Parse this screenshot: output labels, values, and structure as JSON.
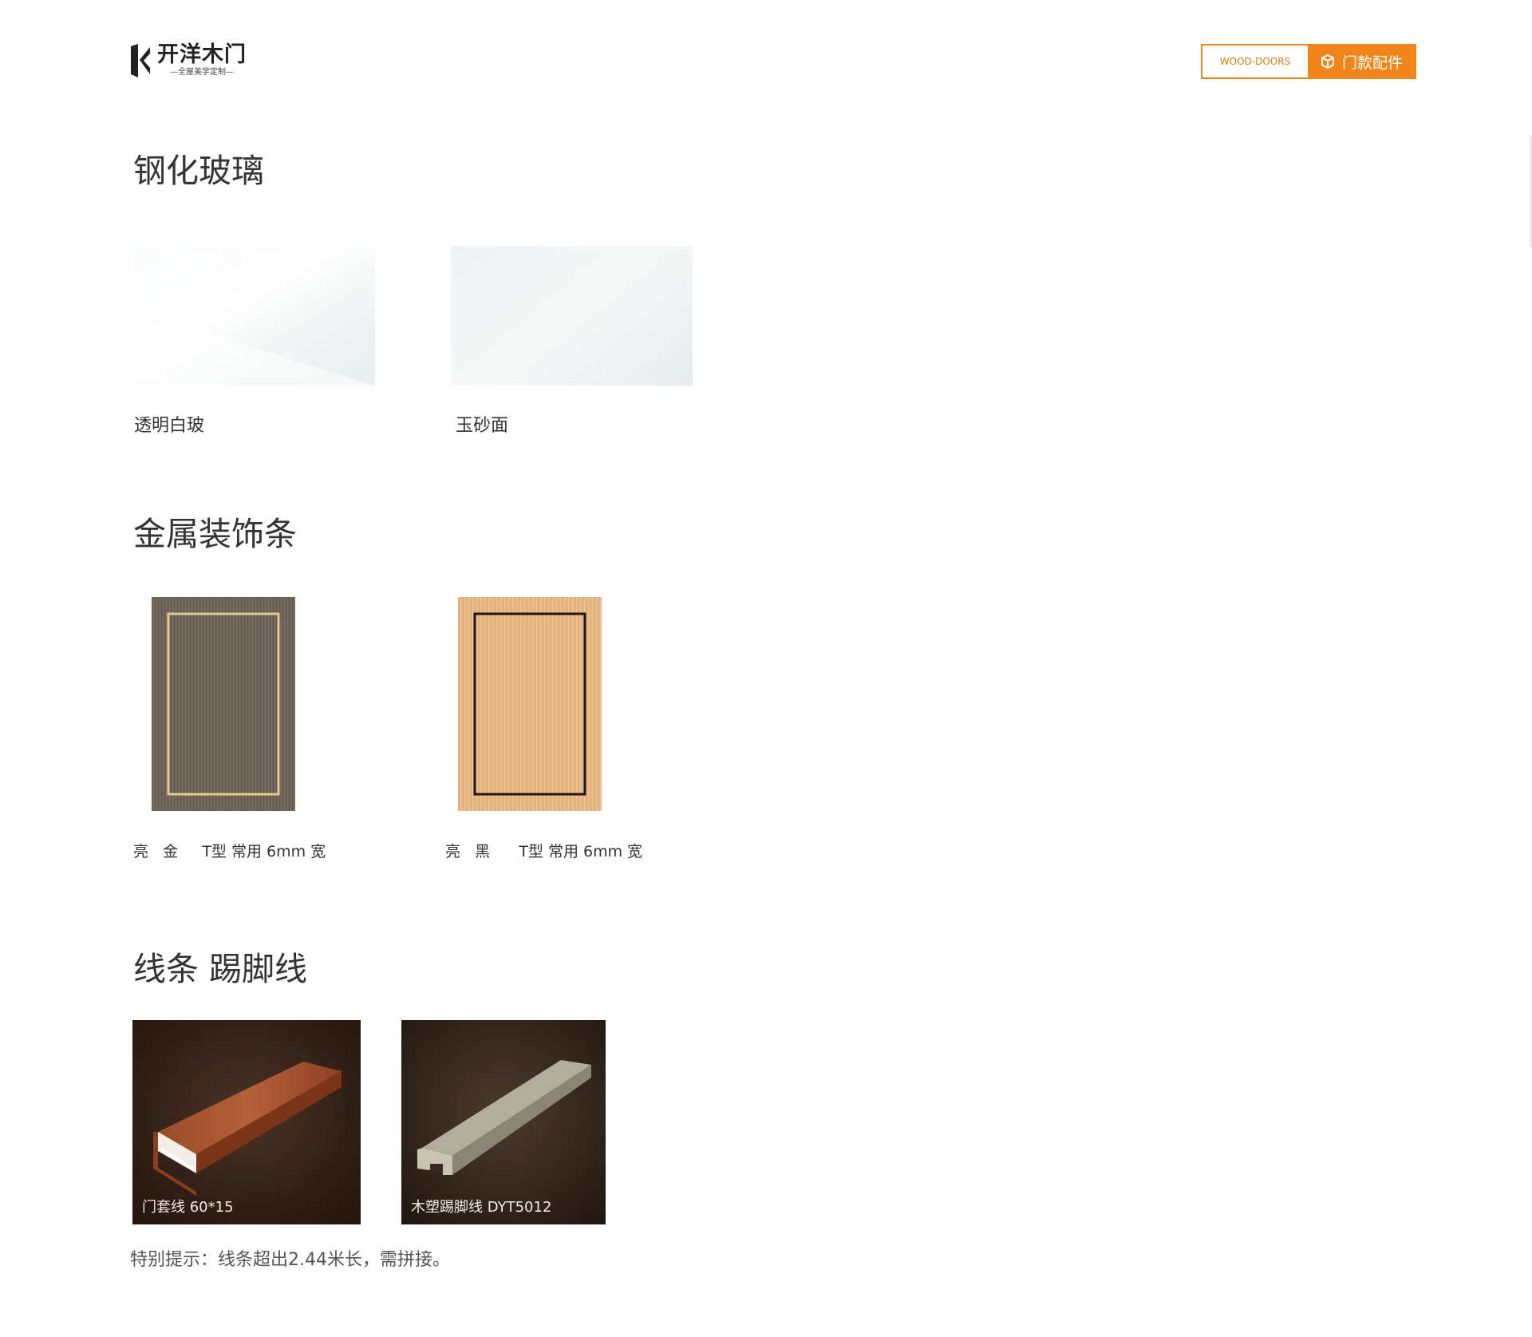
{
  "header": {
    "logo_name": "开洋木门",
    "logo_slogan": "—全屋美学定制—",
    "nav_en": "WOOD-DOORS",
    "nav_cn": "门款配件"
  },
  "sections": {
    "glass": {
      "title": "钢化玻璃",
      "items": [
        {
          "label": "透明白玻"
        },
        {
          "label": "玉砂面"
        }
      ]
    },
    "metal": {
      "title": "金属装饰条",
      "items": [
        {
          "label": "亮   金     T型 常用 6mm 宽",
          "frame_color": "#e6c890",
          "base_color": "#6e665b"
        },
        {
          "label": "亮   黑      T型 常用 6mm 宽",
          "frame_color": "#1a1a1a",
          "base_color": "#e9b784"
        }
      ]
    },
    "lines": {
      "title": "线条  踢脚线",
      "items": [
        {
          "caption": "门套线 60*15"
        },
        {
          "caption": "木塑踢脚线 DYT5012"
        }
      ]
    }
  },
  "tip": "特别提示：线条超出2.44米长，需拼接。",
  "colors": {
    "accent": "#f08519"
  }
}
